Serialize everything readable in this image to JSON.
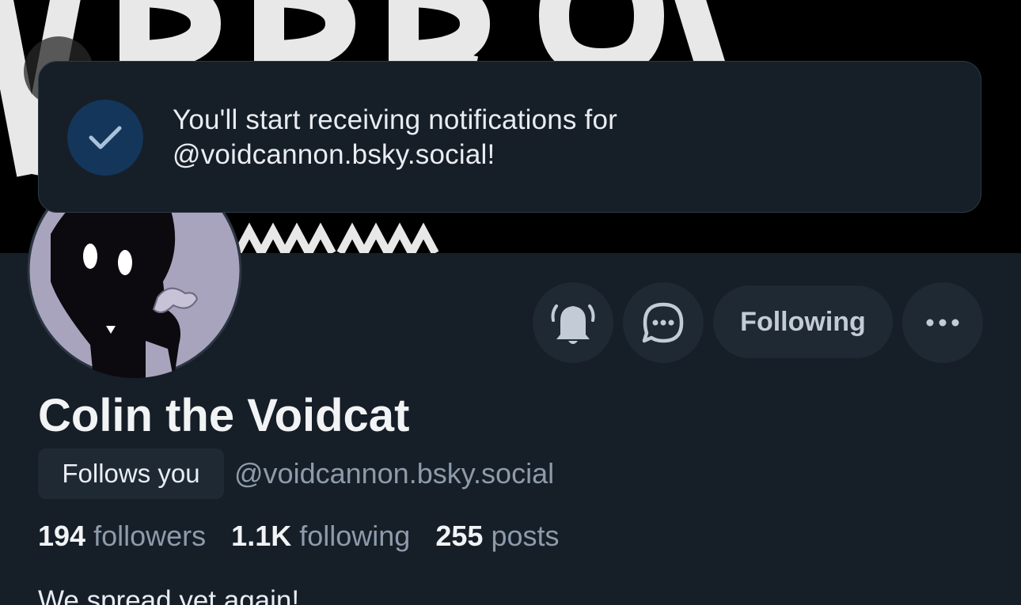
{
  "toast": {
    "icon": "check-icon",
    "line1": "You'll start receiving notifications for",
    "line2": "@voidcannon.bsky.social!"
  },
  "profile": {
    "display_name": "Colin the Voidcat",
    "follows_badge": "Follows you",
    "handle": "@voidcannon.bsky.social",
    "bio": "We spread yet again!"
  },
  "actions": {
    "bell_icon": "bell-ringing-icon",
    "message_icon": "chat-bubble-icon",
    "following_label": "Following",
    "more_icon": "ellipsis-icon"
  },
  "stats": [
    {
      "count": "194",
      "label": "followers"
    },
    {
      "count": "1.1K",
      "label": "following"
    },
    {
      "count": "255",
      "label": "posts"
    }
  ],
  "colors": {
    "background": "#161e27",
    "button": "#1f2934",
    "toast_border": "#2e3a48",
    "check_circle": "#14365a",
    "muted_text": "#8d9bab"
  }
}
